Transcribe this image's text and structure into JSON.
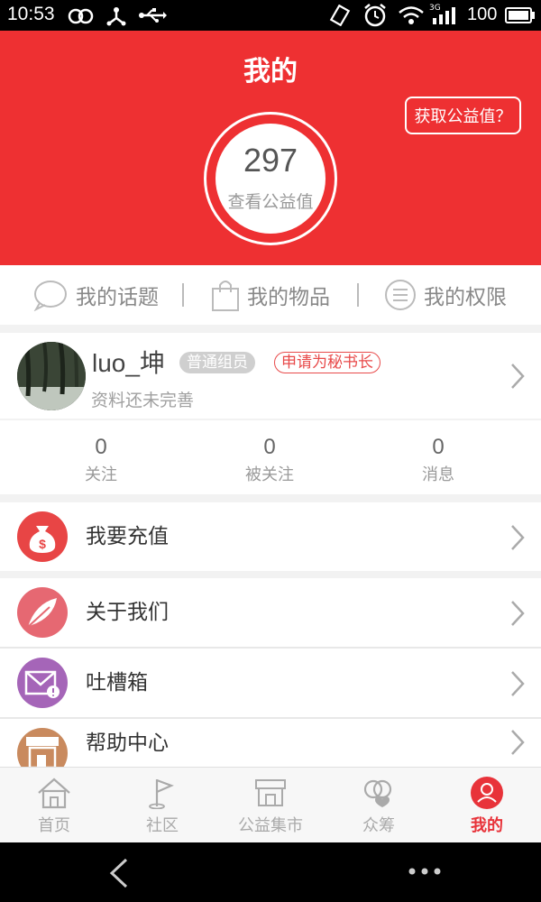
{
  "status_bar": {
    "time": "10:53",
    "battery": "100",
    "network": "3G"
  },
  "header": {
    "title": "我的",
    "get_points_button": "获取公益值？",
    "points_value": "297",
    "points_label": "查看公益值"
  },
  "tabs": [
    {
      "label": "我的话题",
      "icon": "chat-bubble-icon"
    },
    {
      "label": "我的物品",
      "icon": "shopping-bag-icon"
    },
    {
      "label": "我的权限",
      "icon": "list-circle-icon"
    }
  ],
  "profile": {
    "username": "luo_坤",
    "role_badge": "普通组员",
    "apply_badge": "申请为秘书长",
    "subtitle": "资料还未完善"
  },
  "stats": [
    {
      "value": "0",
      "label": "关注"
    },
    {
      "value": "0",
      "label": "被关注"
    },
    {
      "value": "0",
      "label": "消息"
    }
  ],
  "menu": {
    "recharge": "我要充值",
    "about": "关于我们",
    "feedback": "吐槽箱",
    "help": "帮助中心"
  },
  "tabbar": [
    {
      "label": "首页",
      "icon": "home-icon"
    },
    {
      "label": "社区",
      "icon": "flag-icon"
    },
    {
      "label": "公益集市",
      "icon": "market-icon"
    },
    {
      "label": "众筹",
      "icon": "crowdfund-icon"
    },
    {
      "label": "我的",
      "icon": "user-icon",
      "active": true
    }
  ],
  "colors": {
    "brand_red": "#ee3032",
    "text_gray": "#888888"
  }
}
